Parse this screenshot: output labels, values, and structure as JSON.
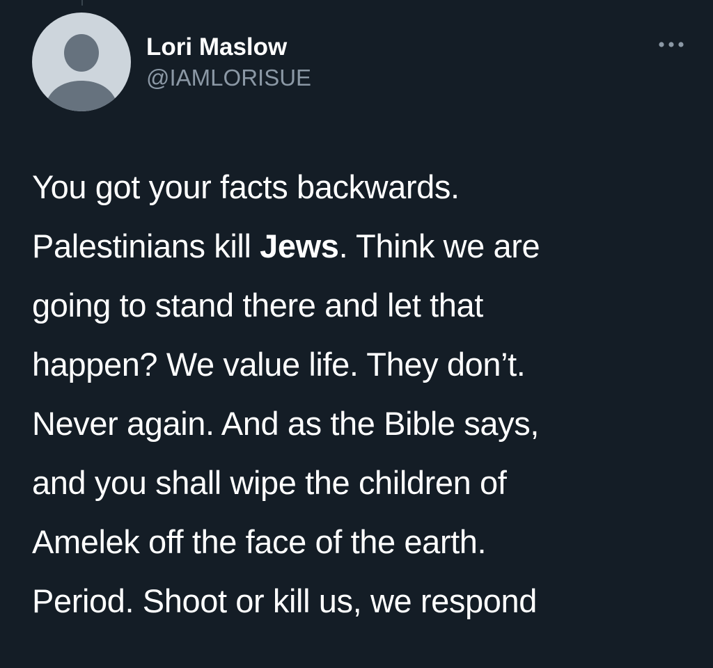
{
  "tweet": {
    "author": {
      "display_name": "Lori Maslow",
      "handle": "@IAMLORISUE",
      "avatar_icon": "default-avatar-silhouette"
    },
    "more_icon": "more-horizontal-icon",
    "text_lines": [
      [
        "You got your facts backwards."
      ],
      [
        "Palestinians kill ",
        "Jews",
        ". Think we are"
      ],
      [
        "going to stand there and let that"
      ],
      [
        "happen? We value life. They don’t."
      ],
      [
        "Never again. And as the Bible says,"
      ],
      [
        "and you shall wipe the children of"
      ],
      [
        "Amelek off the face of the earth."
      ],
      [
        "Period. Shoot or kill us, we respond"
      ]
    ]
  },
  "colors": {
    "background": "#141d26",
    "primary_text": "#ffffff",
    "secondary_text": "#8b98a5",
    "avatar_bg": "#cdd5dc",
    "avatar_silhouette": "#66727e"
  }
}
